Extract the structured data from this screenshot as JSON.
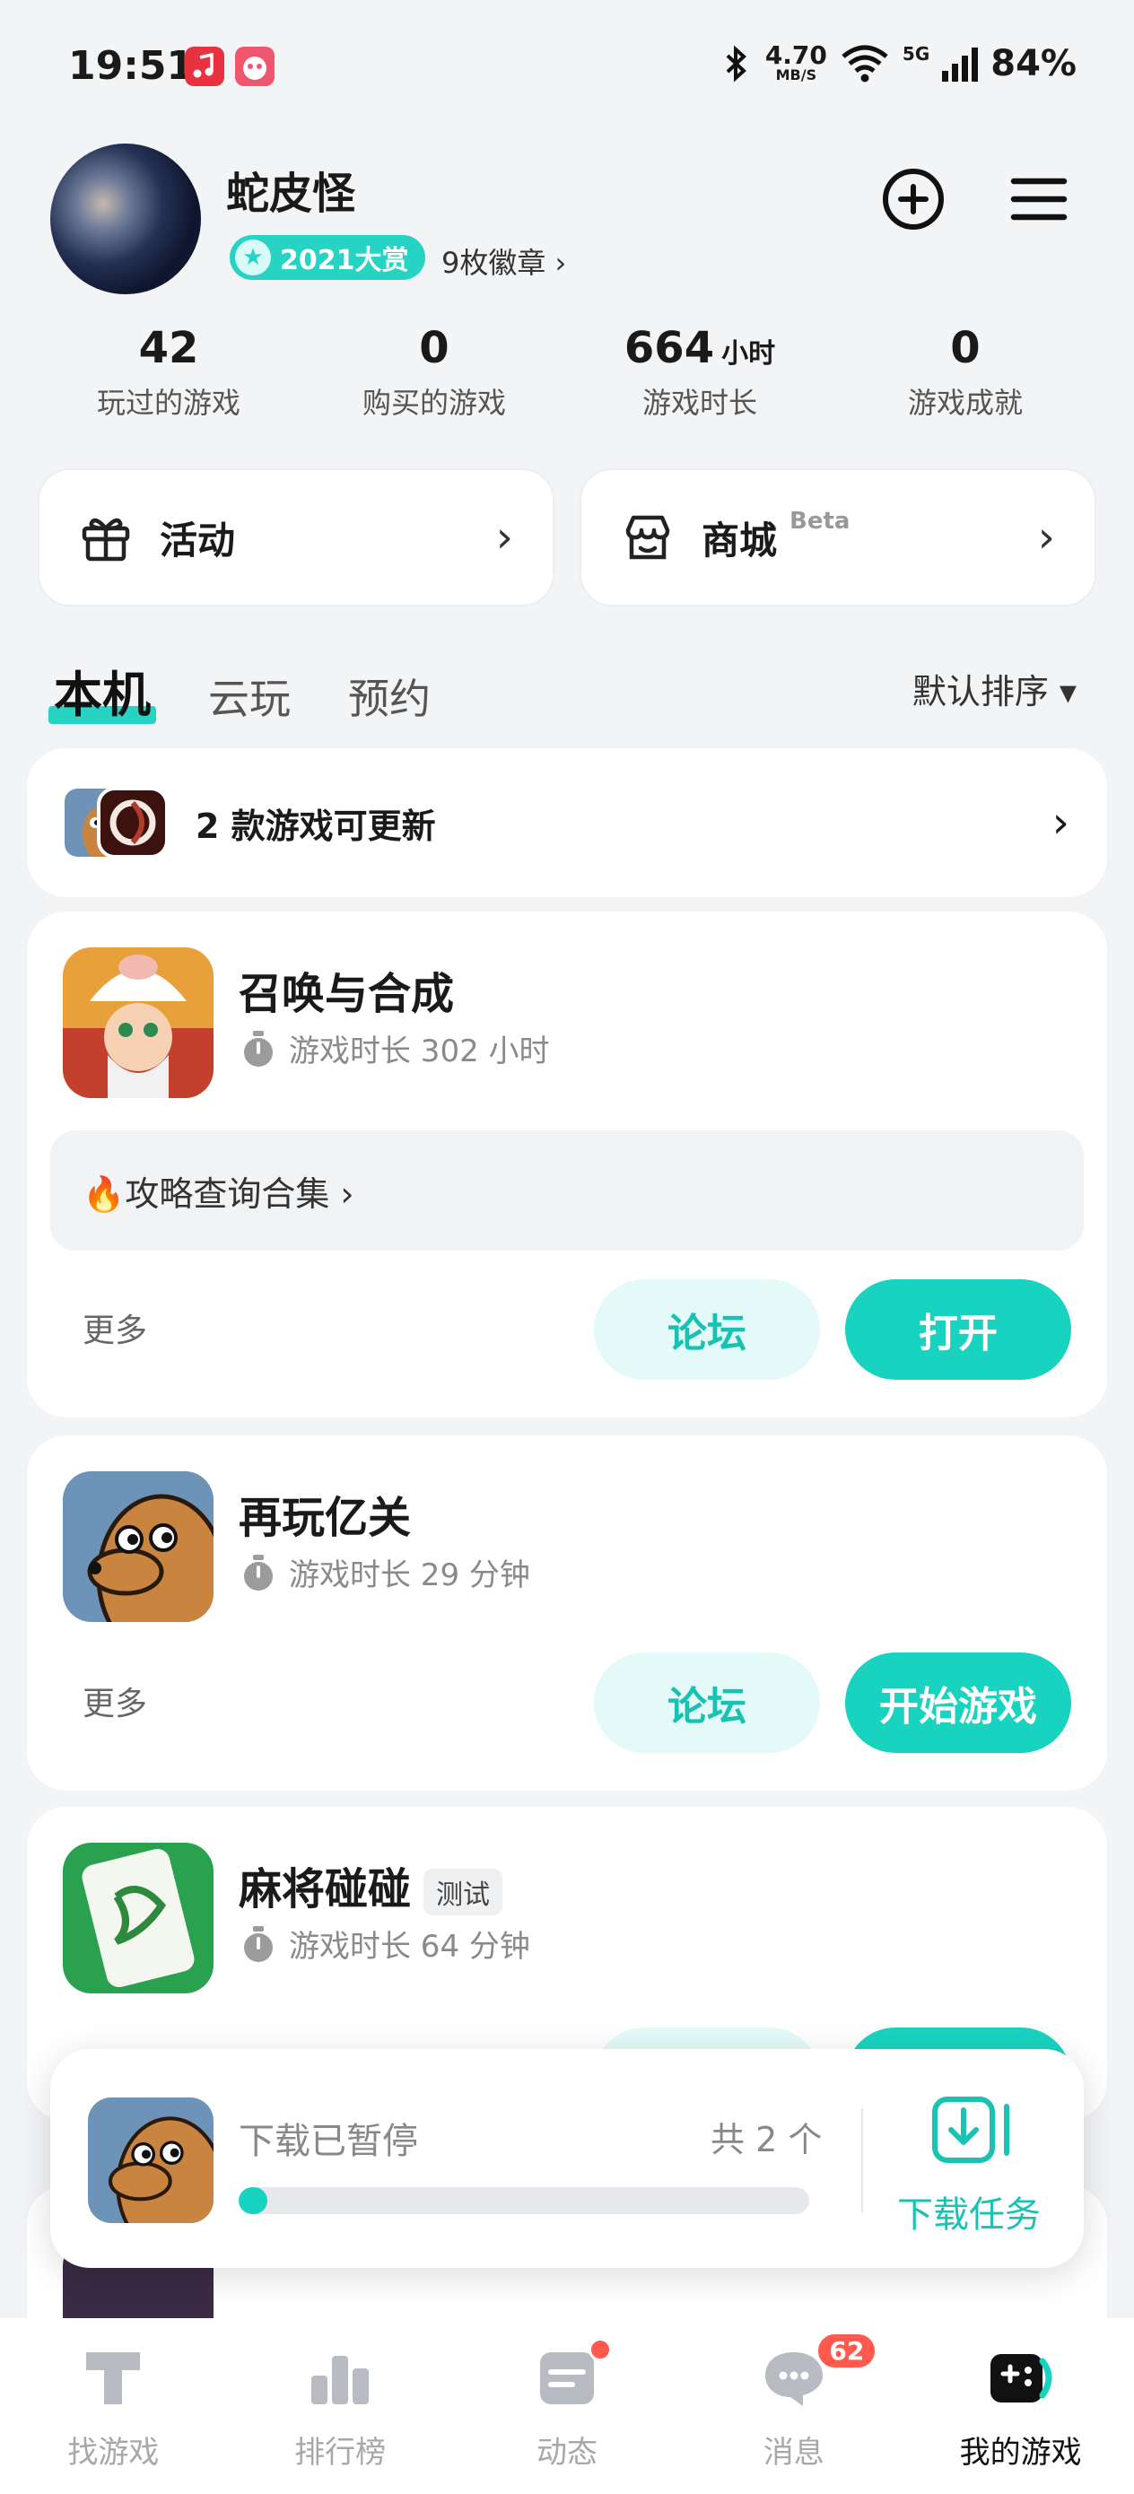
{
  "status_bar": {
    "time": "19:51",
    "net_speed": "4.70",
    "net_unit": "MB/S",
    "signal": "5G",
    "battery": "84%"
  },
  "profile": {
    "name": "蛇皮怪",
    "award": "2021大赏",
    "badges": "9枚徽章 ›"
  },
  "stats": [
    {
      "value": "42",
      "unit": "",
      "label": "玩过的游戏"
    },
    {
      "value": "0",
      "unit": "",
      "label": "购买的游戏"
    },
    {
      "value": "664",
      "unit": "小时",
      "label": "游戏时长"
    },
    {
      "value": "0",
      "unit": "",
      "label": "游戏成就"
    }
  ],
  "quick": {
    "activity": "活动",
    "store": "商城",
    "store_tag": "Beta"
  },
  "tabs": {
    "local": "本机",
    "cloud": "云玩",
    "reserve": "预约",
    "sort": "默认排序 ▾"
  },
  "update": {
    "text": "2 款游戏可更新"
  },
  "games": [
    {
      "title": "召唤与合成",
      "tag": "",
      "time": "游戏时长 302 小时",
      "guide": "🔥攻略查询合集 ›",
      "more": "更多",
      "forum": "论坛",
      "action": "打开"
    },
    {
      "title": "再玩亿关",
      "tag": "",
      "time": "游戏时长 29 分钟",
      "more": "更多",
      "forum": "论坛",
      "action": "开始游戏"
    },
    {
      "title": "麻将碰碰",
      "tag": "测试",
      "time": "游戏时长 64 分钟"
    }
  ],
  "download": {
    "status": "下载已暂停",
    "count": "共 2 个",
    "progress": 0.05,
    "task_label": "下载任务"
  },
  "nav": {
    "find": "找游戏",
    "rank": "排行榜",
    "feed": "动态",
    "msg": "消息",
    "msg_badge": "62",
    "mine": "我的游戏"
  },
  "colors": {
    "accent": "#19d3c1",
    "badge": "#ff5a4b"
  }
}
